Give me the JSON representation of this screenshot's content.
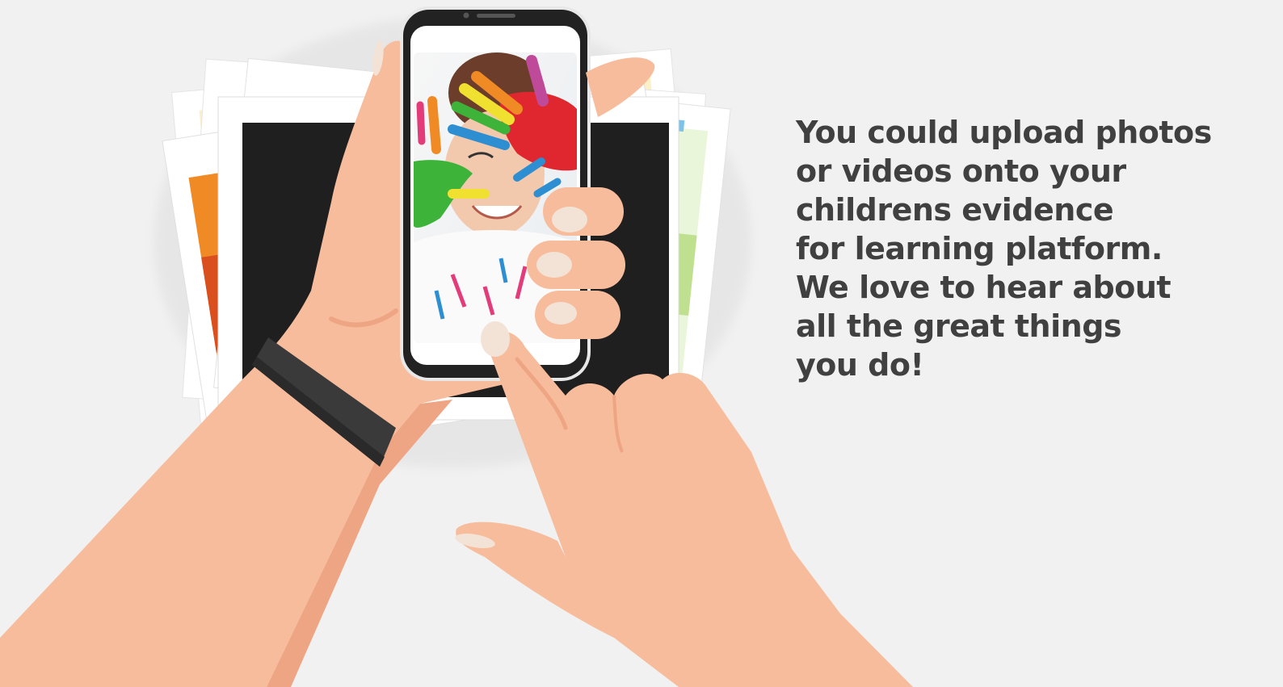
{
  "message": {
    "lines": [
      "You could upload photos",
      "or videos onto your",
      "childrens evidence",
      "for learning platform.",
      "We love to hear about",
      "all the great things",
      "you do!"
    ]
  },
  "colors": {
    "background": "#f1f1f1",
    "skin": "#f7bc9c",
    "skin_shadow": "#eea584",
    "nail": "#f3e3d6",
    "phone_body": "#222222",
    "wristband": "#3a3a3a",
    "text": "#404040"
  },
  "icons": {
    "illustration": "hands-holding-smartphone-illustration"
  }
}
